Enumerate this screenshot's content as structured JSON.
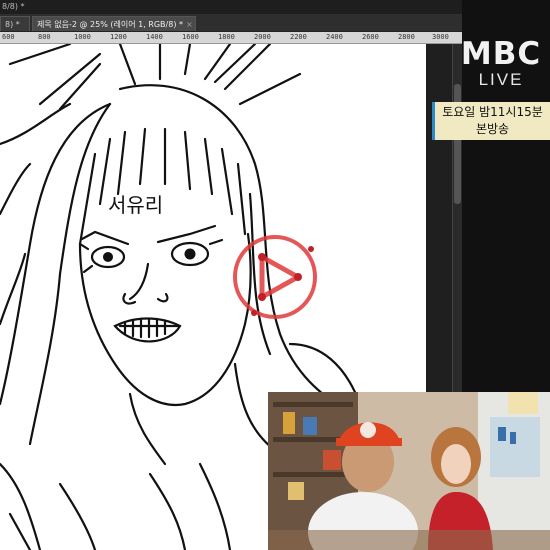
{
  "window": {
    "title": "8/8) *"
  },
  "tabs": [
    {
      "label": "8) *",
      "close": ""
    },
    {
      "label": "제목 없음-2 @ 25% (레이어 1, RGB/8) *",
      "close": "×"
    }
  ],
  "ruler": {
    "labels": [
      "600",
      "800",
      "1000",
      "1200",
      "1400",
      "1600",
      "1800",
      "2000",
      "2200",
      "2400",
      "2600",
      "2800",
      "3000"
    ]
  },
  "drawing": {
    "name_text": "서유리"
  },
  "broadcast": {
    "logo": "MBC",
    "live": "LIVE",
    "schedule_line1": "토요일 밤11시15분",
    "schedule_line2": "본방송"
  },
  "colors": {
    "play_button": "#e0393a",
    "schedule_bg": "#f0e9c2",
    "schedule_accent": "#2b8bc8"
  },
  "icons": {
    "play": "play-icon"
  }
}
